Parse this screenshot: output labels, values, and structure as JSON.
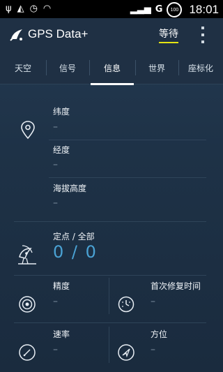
{
  "status_bar": {
    "time": "18:01",
    "battery": "100",
    "icons": [
      "usb-icon",
      "android-icon",
      "alarm-icon",
      "wifi-icon",
      "signal-icon",
      "gprs-icon",
      "battery-icon"
    ]
  },
  "app": {
    "title": "GPS Data+",
    "wait_label": "等待"
  },
  "tabs": [
    {
      "label": "天空"
    },
    {
      "label": "信号"
    },
    {
      "label": "信息",
      "selected": true
    },
    {
      "label": "世界"
    },
    {
      "label": "座标化"
    }
  ],
  "info": {
    "latitude": {
      "label": "纬度",
      "value": "–"
    },
    "longitude": {
      "label": "经度",
      "value": "–"
    },
    "altitude": {
      "label": "海拔高度",
      "value": "–"
    },
    "fix": {
      "label": "定点 / 全部",
      "value": "0 / 0"
    },
    "accuracy": {
      "label": "精度",
      "value": "–"
    },
    "ttff": {
      "label": "首次修复时间",
      "value": "–"
    },
    "speed": {
      "label": "速率",
      "value": "–"
    },
    "bearing": {
      "label": "方位",
      "value": "–"
    }
  },
  "colors": {
    "accent": "#4aa2d4",
    "wait_underline": "#e5e513",
    "background": "#1e3247"
  }
}
